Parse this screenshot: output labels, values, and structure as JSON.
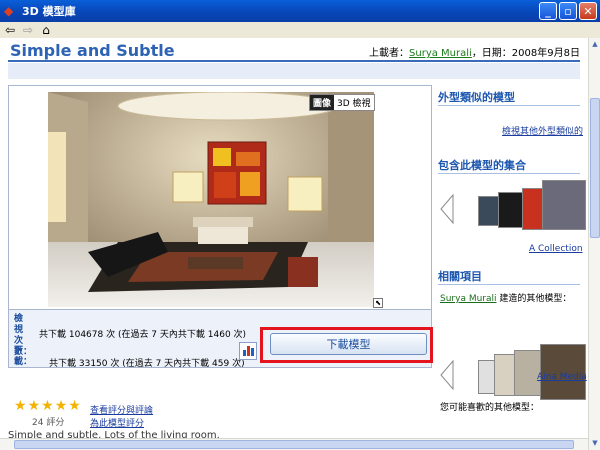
{
  "window": {
    "title": "3D 模型庫"
  },
  "page": {
    "title": "Simple and Subtle",
    "uploader_prefix": "上載者：",
    "uploader_name": "Surya Murali",
    "date_text": "，日期：2008年9月8日"
  },
  "viewer": {
    "tab_image": "圖像",
    "tab_3d": "3D 檢視",
    "expand_icon": "expand-icon"
  },
  "stats": {
    "views_label": "檢視次數：",
    "views_text": "共下載 104678 次 (在過去 7 天內共下載 1460 次)",
    "downloads_label": "下載：",
    "downloads_text": "共下載 33150 次 (在過去 7 天內共下載 459 次)"
  },
  "download_button": "下載模型",
  "rating": {
    "stars": 5,
    "count_text": "24 評分",
    "link_reviews": "查看評分與評論",
    "link_rate": "為此模型評分"
  },
  "body_text_cut": "Simple and subtle. Lots of the living room.",
  "sidebar": {
    "similar_heading": "外型類似的模型",
    "similar_link": "檢視其他外型類似的",
    "collections_heading": "包含此模型的集合",
    "collection_caption": "A Collection",
    "related_heading": "相關項目",
    "related_user": "Surya Murali",
    "related_suffix": "建造的其他模型：",
    "related_caption": "Aina Media",
    "maybe_like": "您可能喜歡的其他模型："
  },
  "colors": {
    "title_blue": "#2d63b4",
    "highlight_red": "#e4141e",
    "star_gold": "#f3b300",
    "link_green": "#1a7a1a"
  }
}
